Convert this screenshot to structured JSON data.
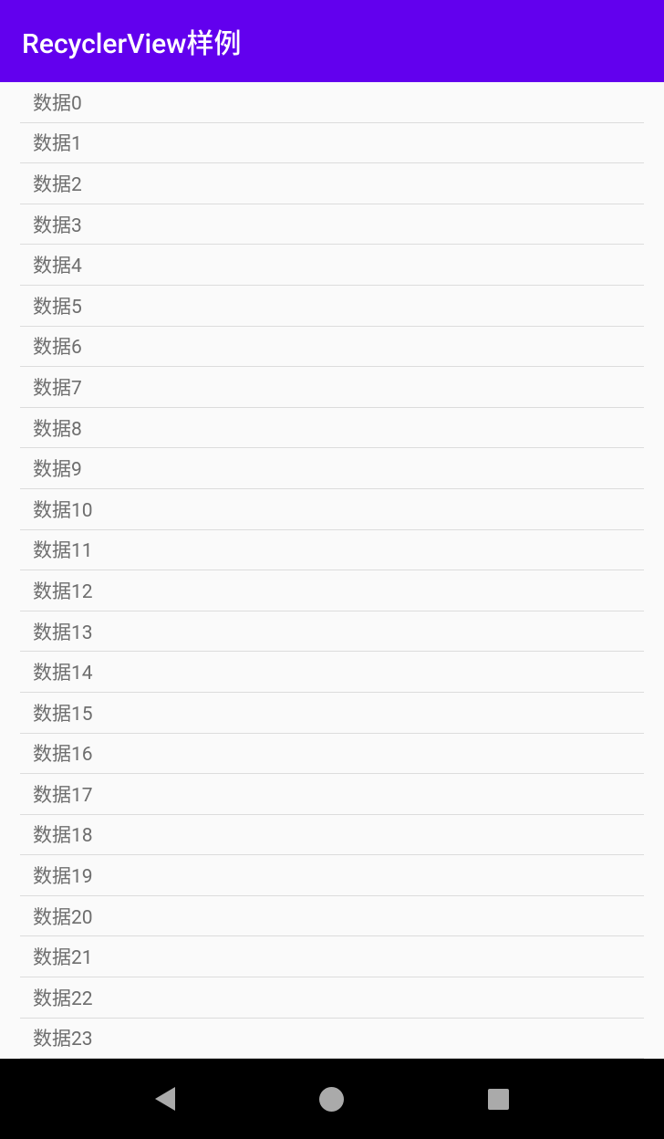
{
  "appBar": {
    "title": "RecyclerView样例"
  },
  "list": {
    "items": [
      {
        "label": "数据0"
      },
      {
        "label": "数据1"
      },
      {
        "label": "数据2"
      },
      {
        "label": "数据3"
      },
      {
        "label": "数据4"
      },
      {
        "label": "数据5"
      },
      {
        "label": "数据6"
      },
      {
        "label": "数据7"
      },
      {
        "label": "数据8"
      },
      {
        "label": "数据9"
      },
      {
        "label": "数据10"
      },
      {
        "label": "数据11"
      },
      {
        "label": "数据12"
      },
      {
        "label": "数据13"
      },
      {
        "label": "数据14"
      },
      {
        "label": "数据15"
      },
      {
        "label": "数据16"
      },
      {
        "label": "数据17"
      },
      {
        "label": "数据18"
      },
      {
        "label": "数据19"
      },
      {
        "label": "数据20"
      },
      {
        "label": "数据21"
      },
      {
        "label": "数据22"
      },
      {
        "label": "数据23"
      }
    ]
  }
}
